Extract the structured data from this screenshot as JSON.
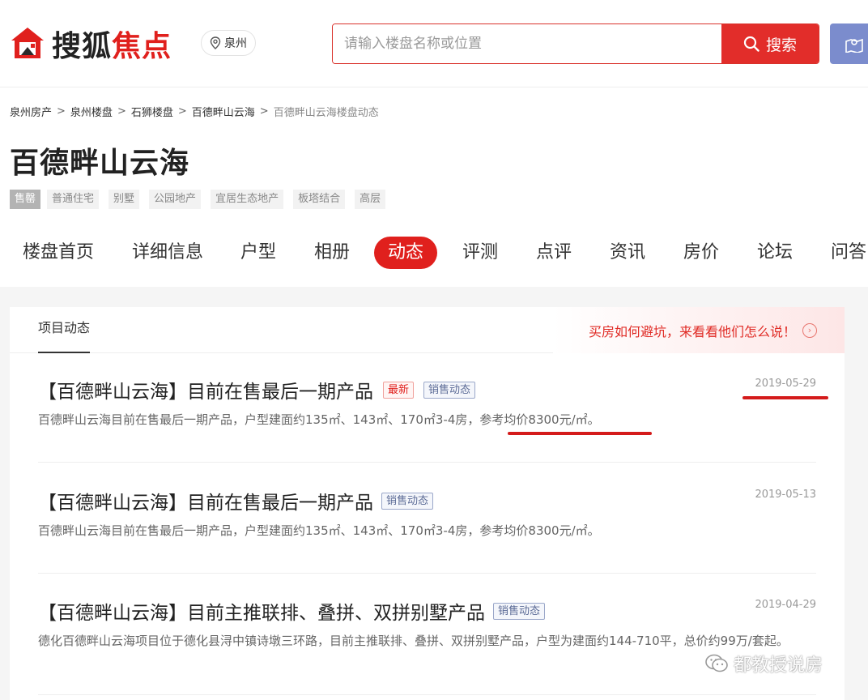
{
  "header": {
    "logo_black": "搜狐",
    "logo_red": "焦点",
    "city": "泉州",
    "search_placeholder": "请输入楼盘名称或位置",
    "search_button": "搜索"
  },
  "breadcrumb": [
    "泉州房产",
    "泉州楼盘",
    "石狮楼盘",
    "百德畔山云海",
    "百德畔山云海楼盘动态"
  ],
  "breadcrumb_sep": ">",
  "project": {
    "title": "百德畔山云海",
    "status_tag": "售罄",
    "tags": [
      "普通住宅",
      "别墅",
      "公园地产",
      "宜居生态地产",
      "板塔结合",
      "高层"
    ]
  },
  "nav": [
    {
      "label": "楼盘首页"
    },
    {
      "label": "详细信息"
    },
    {
      "label": "户型"
    },
    {
      "label": "相册"
    },
    {
      "label": "动态",
      "active": true
    },
    {
      "label": "评测"
    },
    {
      "label": "点评"
    },
    {
      "label": "资讯"
    },
    {
      "label": "房价"
    },
    {
      "label": "论坛"
    },
    {
      "label": "问答"
    }
  ],
  "panel": {
    "tab": "项目动态",
    "promo": "买房如何避坑，来看看他们怎么说！"
  },
  "news": [
    {
      "title": "【百德畔山云海】目前在售最后一期产品",
      "badges": [
        "最新",
        "销售动态"
      ],
      "date": "2019-05-29",
      "desc_main": "百德畔山云海目前在售最后一期产品，户型建面约135㎡、143㎡、170㎡3-4房，",
      "desc_highlight": "参考均价8300元/㎡。"
    },
    {
      "title": "【百德畔山云海】目前在售最后一期产品",
      "badges": [
        "销售动态"
      ],
      "date": "2019-05-13",
      "desc_main": "百德畔山云海目前在售最后一期产品，户型建面约135㎡、143㎡、170㎡3-4房，",
      "desc_highlight": "参考均价8300元/㎡。"
    },
    {
      "title": "【百德畔山云海】目前主推联排、叠拼、双拼别墅产品",
      "badges": [
        "销售动态"
      ],
      "date": "2019-04-29",
      "desc_main": "德化百德畔山云海项目位于德化县浔中镇诗墩三环路，目前主推联排、叠拼、双拼别墅产品，户型为建面约144-710平，总价约99万/套起。",
      "desc_highlight": ""
    }
  ],
  "watermark": "都教授说房",
  "colors": {
    "brand_red": "#e0201d",
    "map_button": "#7b8ccd"
  }
}
